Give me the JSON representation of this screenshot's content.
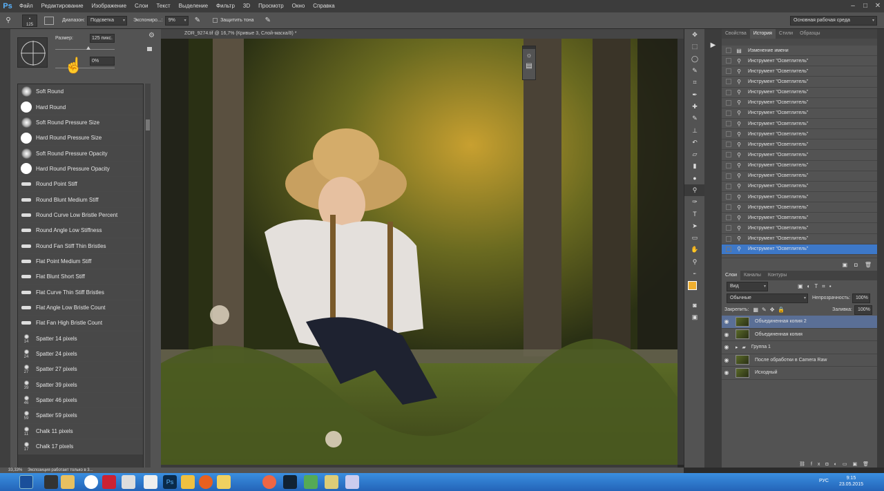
{
  "app": {
    "logo": "Ps",
    "menus": [
      "Файл",
      "Редактирование",
      "Изображение",
      "Слои",
      "Текст",
      "Выделение",
      "Фильтр",
      "3D",
      "Просмотр",
      "Окно",
      "Справка"
    ]
  },
  "options": {
    "brush_size": "125",
    "range_label": "Диапазон:",
    "range_value": "Подсветка",
    "exposure_label": "Экспониро...:",
    "exposure_value": "9%",
    "protect_label": "Защитить тона",
    "workspace": "Основная рабочая среда"
  },
  "brush_picker": {
    "size_label": "Размер:",
    "size_value": "125 пикс.",
    "hardness_value": "0%",
    "brushes": [
      {
        "name": "Soft Round",
        "thumb": "soft",
        "num": ""
      },
      {
        "name": "Hard Round",
        "thumb": "hard",
        "num": ""
      },
      {
        "name": "Soft Round Pressure Size",
        "thumb": "soft",
        "num": ""
      },
      {
        "name": "Hard Round Pressure Size",
        "thumb": "hard",
        "num": ""
      },
      {
        "name": "Soft Round Pressure Opacity",
        "thumb": "soft",
        "num": ""
      },
      {
        "name": "Hard Round Pressure Opacity",
        "thumb": "hard",
        "num": ""
      },
      {
        "name": "Round Point Stiff",
        "thumb": "bristle",
        "num": ""
      },
      {
        "name": "Round Blunt Medium Stiff",
        "thumb": "bristle",
        "num": ""
      },
      {
        "name": "Round Curve Low Bristle Percent",
        "thumb": "bristle",
        "num": ""
      },
      {
        "name": "Round Angle Low Stiffness",
        "thumb": "bristle",
        "num": ""
      },
      {
        "name": "Round Fan Stiff Thin Bristles",
        "thumb": "bristle",
        "num": ""
      },
      {
        "name": "Flat Point Medium Stiff",
        "thumb": "bristle",
        "num": ""
      },
      {
        "name": "Flat Blunt Short Stiff",
        "thumb": "bristle",
        "num": ""
      },
      {
        "name": "Flat Curve Thin Stiff Bristles",
        "thumb": "bristle",
        "num": ""
      },
      {
        "name": "Flat Angle Low Bristle Count",
        "thumb": "bristle",
        "num": ""
      },
      {
        "name": "Flat Fan High Bristle Count",
        "thumb": "bristle",
        "num": ""
      },
      {
        "name": "Spatter 14 pixels",
        "thumb": "spatter",
        "num": "14"
      },
      {
        "name": "Spatter 24 pixels",
        "thumb": "spatter",
        "num": "24"
      },
      {
        "name": "Spatter 27 pixels",
        "thumb": "spatter",
        "num": "27"
      },
      {
        "name": "Spatter 39 pixels",
        "thumb": "spatter",
        "num": "39"
      },
      {
        "name": "Spatter 46 pixels",
        "thumb": "spatter",
        "num": "46"
      },
      {
        "name": "Spatter 59 pixels",
        "thumb": "spatter",
        "num": "59"
      },
      {
        "name": "Chalk 11 pixels",
        "thumb": "spatter",
        "num": "11"
      },
      {
        "name": "Chalk 17 pixels",
        "thumb": "spatter",
        "num": "17"
      }
    ]
  },
  "document": {
    "tab_title": "ZOR_9274.tif @ 16,7% (Кривые 3, Слой-маска/8) *"
  },
  "history": {
    "tabs": [
      "Свойства",
      "История",
      "Стили",
      "Образцы"
    ],
    "items": [
      {
        "label": "Изменение имени",
        "icon": "rename"
      },
      {
        "label": "Инструмент \"Осветлитель\"",
        "icon": "dodge"
      },
      {
        "label": "Инструмент \"Осветлитель\"",
        "icon": "dodge"
      },
      {
        "label": "Инструмент \"Осветлитель\"",
        "icon": "dodge"
      },
      {
        "label": "Инструмент \"Осветлитель\"",
        "icon": "dodge"
      },
      {
        "label": "Инструмент \"Осветлитель\"",
        "icon": "dodge"
      },
      {
        "label": "Инструмент \"Осветлитель\"",
        "icon": "dodge"
      },
      {
        "label": "Инструмент \"Осветлитель\"",
        "icon": "dodge"
      },
      {
        "label": "Инструмент \"Осветлитель\"",
        "icon": "dodge"
      },
      {
        "label": "Инструмент \"Осветлитель\"",
        "icon": "dodge"
      },
      {
        "label": "Инструмент \"Осветлитель\"",
        "icon": "dodge"
      },
      {
        "label": "Инструмент \"Осветлитель\"",
        "icon": "dodge"
      },
      {
        "label": "Инструмент \"Осветлитель\"",
        "icon": "dodge"
      },
      {
        "label": "Инструмент \"Осветлитель\"",
        "icon": "dodge"
      },
      {
        "label": "Инструмент \"Осветлитель\"",
        "icon": "dodge"
      },
      {
        "label": "Инструмент \"Осветлитель\"",
        "icon": "dodge"
      },
      {
        "label": "Инструмент \"Осветлитель\"",
        "icon": "dodge"
      },
      {
        "label": "Инструмент \"Осветлитель\"",
        "icon": "dodge"
      },
      {
        "label": "Инструмент \"Осветлитель\"",
        "icon": "dodge"
      },
      {
        "label": "Инструмент \"Осветлитель\"",
        "icon": "dodge"
      }
    ]
  },
  "layers": {
    "tabs": [
      "Слои",
      "Каналы",
      "Контуры"
    ],
    "filter": "Вид",
    "blend_mode": "Обычные",
    "opacity_label": "Непрозрачность:",
    "opacity_value": "100%",
    "lock_label": "Закрепить:",
    "fill_label": "Заливка:",
    "fill_value": "100%",
    "items": [
      {
        "name": "Объединенная копия 2",
        "selected": true,
        "group": false
      },
      {
        "name": "Объединенная копия",
        "selected": false,
        "group": false
      },
      {
        "name": "Группа 1",
        "selected": false,
        "group": true
      },
      {
        "name": "После обработки в Camera Raw",
        "selected": false,
        "group": false
      },
      {
        "name": "Исходный",
        "selected": false,
        "group": false
      }
    ]
  },
  "status": {
    "zoom": "33,33%",
    "message": "Экспозиция работает только в 3..."
  },
  "taskbar": {
    "lang": "РУС",
    "time": "9:15",
    "date": "23.05.2015"
  },
  "colors": {
    "foreground": "#f0b030",
    "selection": "#3d78c8"
  }
}
